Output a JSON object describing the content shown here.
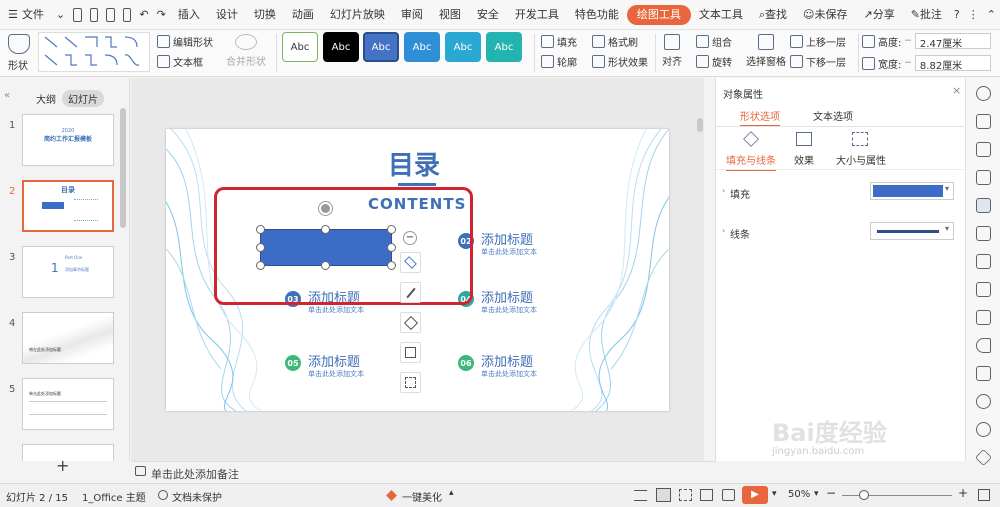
{
  "menubar": {
    "file": "文件",
    "file_first": "插入",
    "items": [
      "插入",
      "设计",
      "切换",
      "动画",
      "幻灯片放映",
      "审阅",
      "视图",
      "安全",
      "开发工具",
      "特色功能",
      "绘图工具",
      "文本工具"
    ],
    "active_index": 10,
    "search": "查找",
    "unsaved": "未保存",
    "share": "分享",
    "comment": "批注"
  },
  "ribbon": {
    "shape_label": "形状",
    "edit_shape": "编辑形状",
    "text_box": "文本框",
    "merge_shape": "合并形状",
    "style_sample": "Abc",
    "fill": "填充",
    "format_brush": "格式刷",
    "outline": "轮廓",
    "shape_effect": "形状效果",
    "align": "对齐",
    "group": "组合",
    "rotate": "旋转",
    "select_pane": "选择窗格",
    "bring_forward": "上移一层",
    "send_backward": "下移一层",
    "height_label": "高度:",
    "height_value": "2.47厘米",
    "width_label": "宽度:",
    "width_value": "8.82厘米"
  },
  "left_panel": {
    "outline_tab": "大纲",
    "slides_tab": "幻灯片",
    "slide_numbers": [
      "1",
      "2",
      "3",
      "4",
      "5"
    ],
    "thumb1_year": "2020",
    "thumb1_title": "简约工作汇报模板",
    "thumb2_title": "目录",
    "thumb3_part": "Part One",
    "thumb3_num": "1",
    "thumb3_title": "添加章节标题",
    "thumb4_text": "带左此处添加标题",
    "thumb5_text": "单击此处添加标题",
    "add_slide": "+"
  },
  "slide": {
    "title": "目录",
    "subtitle": "CONTENTS",
    "items": [
      {
        "num": "02",
        "title": "添加标题",
        "sub": "单击此处添加文本"
      },
      {
        "num": "03",
        "title": "添加标题",
        "sub": "单击此处添加文本"
      },
      {
        "num": "04",
        "title": "添加标题",
        "sub": "单击此处添加文本"
      },
      {
        "num": "05",
        "title": "添加标题",
        "sub": "单击此处添加文本"
      },
      {
        "num": "06",
        "title": "添加标题",
        "sub": "单击此处添加文本"
      }
    ]
  },
  "right_panel": {
    "title": "对象属性",
    "tab_shape": "形状选项",
    "tab_text": "文本选项",
    "sub_fill_line": "填充与线条",
    "sub_effect": "效果",
    "sub_size": "大小与属性",
    "fill_label": "填充",
    "line_label": "线条",
    "fill_color": "#3b6cc6"
  },
  "notes": {
    "placeholder": "单击此处添加备注"
  },
  "status": {
    "slide_info": "幻灯片 2 / 15",
    "theme": "1_Office 主题",
    "protect": "文档未保护",
    "beautify": "一键美化",
    "zoom": "50%"
  },
  "colors": {
    "accent": "#e8663d",
    "selection_box": "#d0252e",
    "shape_blue": "#3b6cc6"
  },
  "watermark": {
    "brand": "Bai度经验",
    "url": "jingyan.baidu.com"
  }
}
